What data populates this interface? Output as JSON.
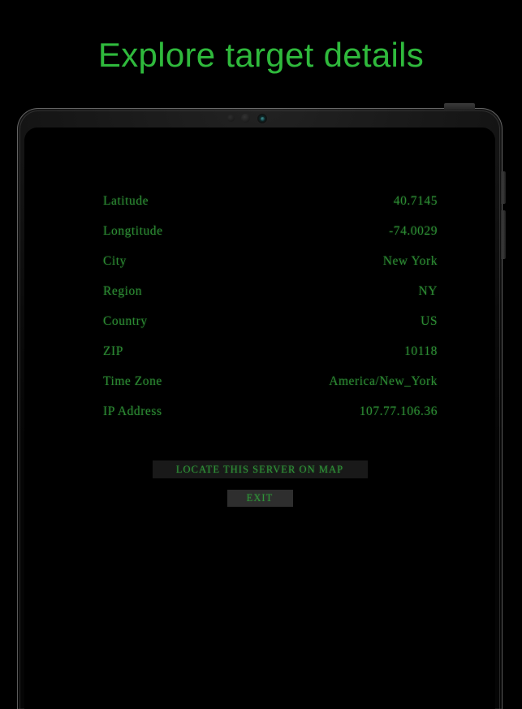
{
  "page": {
    "title": "Explore target details"
  },
  "device": {
    "type": "tablet-mockup",
    "sensors": [
      "proximity-sensor",
      "ambient-light-sensor",
      "front-camera"
    ],
    "hardware_buttons": [
      "power",
      "volume-up",
      "volume-down"
    ]
  },
  "screen": {
    "details": [
      {
        "label": "Latitude",
        "value": "40.7145"
      },
      {
        "label": "Longtitude",
        "value": "-74.0029"
      },
      {
        "label": "City",
        "value": "New York"
      },
      {
        "label": "Region",
        "value": "NY"
      },
      {
        "label": "Country",
        "value": "US"
      },
      {
        "label": "ZIP",
        "value": "10118"
      },
      {
        "label": "Time Zone",
        "value": "America/New_York"
      },
      {
        "label": "IP Address",
        "value": "107.77.106.36"
      }
    ],
    "actions": {
      "locate_label": "LOCATE THIS SERVER ON MAP",
      "exit_label": "EXIT"
    }
  },
  "colors": {
    "title_green": "#2fb93c",
    "text_green": "#2c8a33",
    "button_green": "#2f9638",
    "screen_background": "#000000",
    "locate_button_background": "#191919",
    "exit_button_background": "#2e2e2e"
  }
}
